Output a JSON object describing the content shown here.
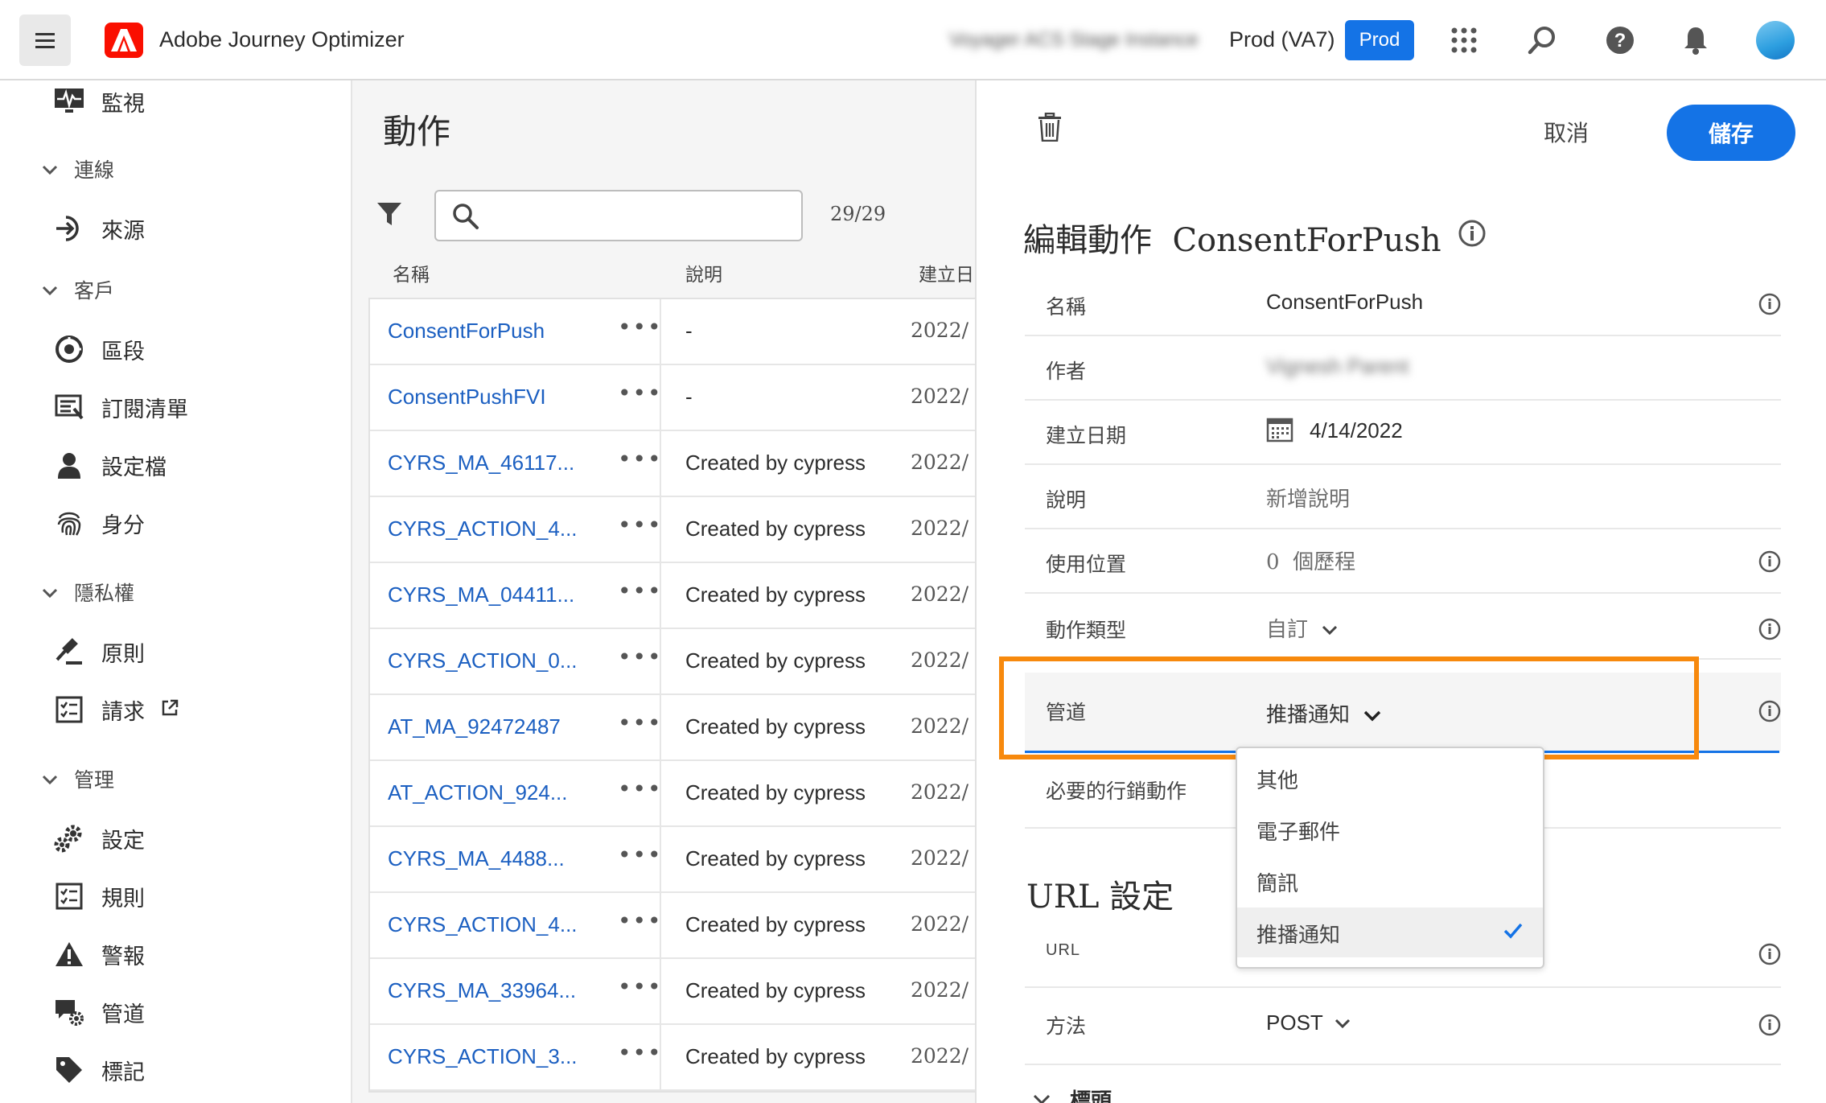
{
  "header": {
    "app_name": "Adobe Journey Optimizer",
    "blurred_instance": "Voyager ACS Stage Instance",
    "org_name": "Prod (VA7)",
    "env_badge": "Prod",
    "icons": [
      "apps-grid-icon",
      "search-icon",
      "help-icon",
      "bell-icon",
      "avatar"
    ]
  },
  "sidebar": {
    "items": [
      {
        "type": "item",
        "label": "監視",
        "icon": "monitor-icon"
      },
      {
        "type": "section",
        "label": "連線"
      },
      {
        "type": "item",
        "label": "來源",
        "icon": "sources-icon"
      },
      {
        "type": "section",
        "label": "客戶"
      },
      {
        "type": "item",
        "label": "區段",
        "icon": "segments-icon"
      },
      {
        "type": "item",
        "label": "訂閱清單",
        "icon": "subscription-list-icon"
      },
      {
        "type": "item",
        "label": "設定檔",
        "icon": "profile-icon"
      },
      {
        "type": "item",
        "label": "身分",
        "icon": "fingerprint-icon"
      },
      {
        "type": "section",
        "label": "隱私權"
      },
      {
        "type": "item",
        "label": "原則",
        "icon": "gavel-icon"
      },
      {
        "type": "item",
        "label": "請求",
        "icon": "checklist-icon"
      },
      {
        "type": "section",
        "label": "管理"
      },
      {
        "type": "item",
        "label": "設定",
        "icon": "gears-icon"
      },
      {
        "type": "item",
        "label": "規則",
        "icon": "rules-icon"
      },
      {
        "type": "item",
        "label": "警報",
        "icon": "alert-icon"
      },
      {
        "type": "item",
        "label": "管道",
        "icon": "channels-icon"
      },
      {
        "type": "item",
        "label": "標記",
        "icon": "tag-icon"
      }
    ]
  },
  "list": {
    "title": "動作",
    "search_placeholder": "",
    "count": "29/29",
    "columns": [
      "名稱",
      "說明",
      "建立日"
    ],
    "rows": [
      {
        "name": "ConsentForPush",
        "desc": "-",
        "date": "2022/"
      },
      {
        "name": "ConsentPushFVI",
        "desc": "-",
        "date": "2022/"
      },
      {
        "name": "CYRS_MA_46117...",
        "desc": "Created by cypress M",
        "date": "2022/"
      },
      {
        "name": "CYRS_ACTION_4...",
        "desc": "Created by cypress E",
        "date": "2022/"
      },
      {
        "name": "CYRS_MA_04411...",
        "desc": "Created by cypress M",
        "date": "2022/"
      },
      {
        "name": "CYRS_ACTION_0...",
        "desc": "Created by cypress E",
        "date": "2022/"
      },
      {
        "name": "AT_MA_92472487",
        "desc": "Created by cypress M",
        "date": "2022/"
      },
      {
        "name": "AT_ACTION_924...",
        "desc": "Created by cypress E",
        "date": "2022/"
      },
      {
        "name": "CYRS_MA_4488...",
        "desc": "Created by cypress M",
        "date": "2022/"
      },
      {
        "name": "CYRS_ACTION_4...",
        "desc": "Created by cypress E",
        "date": "2022/"
      },
      {
        "name": "CYRS_MA_33964...",
        "desc": "Created by cypress M",
        "date": "2022/"
      },
      {
        "name": "CYRS_ACTION_3...",
        "desc": "Created by cypress E",
        "date": "2022/"
      }
    ]
  },
  "edit": {
    "cancel_label": "取消",
    "save_label": "儲存",
    "title_prefix": "編輯動作",
    "title_name": "ConsentForPush",
    "fields": {
      "name_label": "名稱",
      "name_value": "ConsentForPush",
      "author_label": "作者",
      "author_value": "Vignesh Parent",
      "created_label": "建立日期",
      "created_value": "4/14/2022",
      "desc_label": "說明",
      "desc_placeholder": "新增說明",
      "usage_label": "使用位置",
      "usage_count": "0",
      "usage_unit": "個歷程",
      "type_label": "動作類型",
      "type_value": "自訂",
      "channel_label": "管道",
      "channel_value": "推播通知",
      "required_label": "必要的行銷動作"
    },
    "url_section": "URL 設定",
    "url_label": "URL",
    "method_label": "方法",
    "method_value": "POST",
    "headers_section": "標頭"
  },
  "dropdown": {
    "options": [
      "其他",
      "電子郵件",
      "簡訊",
      "推播通知"
    ],
    "selected": "推播通知"
  },
  "colors": {
    "accent": "#1473e6",
    "highlight": "#f7890d",
    "adobe_red": "#fa0f00",
    "link": "#1b5fc1"
  }
}
